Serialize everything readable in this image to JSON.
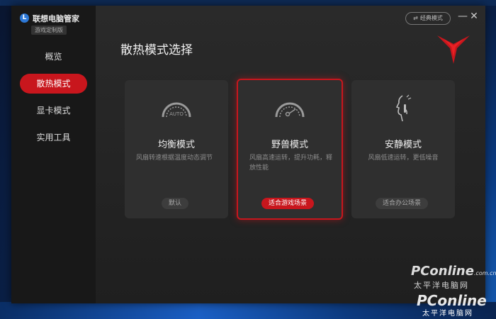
{
  "app": {
    "logo_letter": "L",
    "name": "联想电脑管家",
    "edition": "游戏定制版"
  },
  "window_controls": {
    "classic_mode": "经典模式",
    "minimize": "—",
    "close": "✕"
  },
  "sidebar": {
    "items": [
      {
        "label": "概览",
        "active": false
      },
      {
        "label": "散热模式",
        "active": true
      },
      {
        "label": "显卡模式",
        "active": false
      },
      {
        "label": "实用工具",
        "active": false
      }
    ]
  },
  "main": {
    "title": "散热模式选择"
  },
  "modes": [
    {
      "title": "均衡模式",
      "desc": "风扇转速根据温度动态调节",
      "tag": "默认",
      "icon": "gauge-auto-icon",
      "icon_text": "AUTO",
      "selected": false
    },
    {
      "title": "野兽模式",
      "desc": "风扇高速运转，提升功耗，释放性能",
      "tag": "适合游戏场景",
      "icon": "gauge-high-icon",
      "selected": true
    },
    {
      "title": "安静模式",
      "desc": "风扇低速运转，更低噪音",
      "tag": "适合办公场景",
      "icon": "quiet-face-icon",
      "selected": false
    }
  ],
  "watermark": {
    "brand_top": "PConline",
    "brand_top_suffix": ".com.cn",
    "cn_top": "太平洋电脑网",
    "brand_bottom": "PConline",
    "cn_bottom": "太平洋电脑网"
  },
  "colors": {
    "accent": "#c8161d",
    "window_bg": "#222222",
    "card_bg": "#2f2f2f"
  }
}
